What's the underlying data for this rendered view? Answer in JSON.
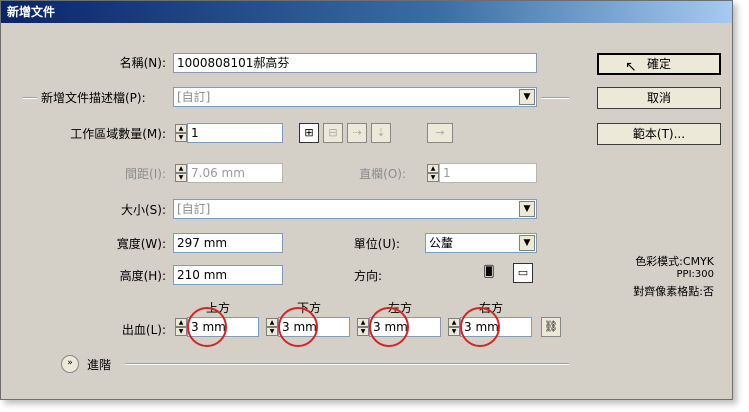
{
  "window": {
    "title": "新增文件"
  },
  "form": {
    "name_label": "名稱(N):",
    "name_value": "1000808101郝高芬",
    "profile_label": "新增文件描述檔(P):",
    "profile_value": "[自訂]",
    "artboards_label": "工作區域數量(M):",
    "artboards_value": "1",
    "spacing_label": "間距(I):",
    "spacing_value": "7.06 mm",
    "columns_label": "直欄(O):",
    "columns_value": "1",
    "size_label": "大小(S):",
    "size_value": "[自訂]",
    "width_label": "寬度(W):",
    "width_value": "297 mm",
    "units_label": "單位(U):",
    "units_value": "公釐",
    "height_label": "高度(H):",
    "height_value": "210 mm",
    "orientation_label": "方向:",
    "bleed_label": "出血(L):",
    "bleed_top_label": "上方",
    "bleed_bottom_label": "下方",
    "bleed_left_label": "左方",
    "bleed_right_label": "右方",
    "bleed_top": "3 mm",
    "bleed_bottom": "3 mm",
    "bleed_left": "3 mm",
    "bleed_right": "3 mm",
    "advanced_label": "進階"
  },
  "buttons": {
    "ok": "確定",
    "cancel": "取消",
    "templates": "範本(T)..."
  },
  "info": {
    "color_mode": "色彩模式:CMYK",
    "ppi": "PPI:300",
    "align_pixel": "對齊像素格點:否"
  },
  "icons": {
    "arrange_grid": "grid-icon",
    "link": "link-icon",
    "portrait": "portrait-icon",
    "landscape": "landscape-icon",
    "chain": "chain-link-icon",
    "chevron": "double-chevron-icon",
    "cursor": "mouse-cursor-icon"
  },
  "colors": {
    "annotation": "#d32525",
    "titlebar": "#0a246a"
  }
}
